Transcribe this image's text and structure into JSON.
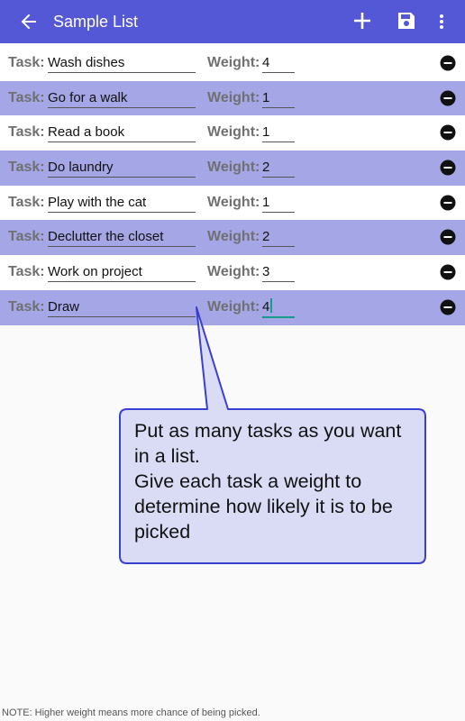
{
  "appbar": {
    "title": "Sample List",
    "back_icon": "arrow-left-icon",
    "add_icon": "plus-icon",
    "save_icon": "floppy-disk-icon",
    "more_icon": "more-vertical-icon",
    "background_color": "#5558d6"
  },
  "list": {
    "task_label": "Task:",
    "weight_label": "Weight:",
    "row_alt_color": "#a4a6e6",
    "rows": [
      {
        "task": "Wash dishes",
        "weight": "4"
      },
      {
        "task": "Go for a walk",
        "weight": "1"
      },
      {
        "task": "Read a book",
        "weight": "1"
      },
      {
        "task": "Do laundry",
        "weight": "2"
      },
      {
        "task": "Play with the cat",
        "weight": "1"
      },
      {
        "task": "Declutter the closet",
        "weight": "2"
      },
      {
        "task": "Work on project",
        "weight": "3"
      },
      {
        "task": "Draw",
        "weight": "4"
      }
    ]
  },
  "callout": {
    "text": "Put as many tasks as you want in a list.\nGive each task a weight to determine how likely it is to be picked"
  },
  "note": "NOTE: Higher weight means more chance of being picked."
}
